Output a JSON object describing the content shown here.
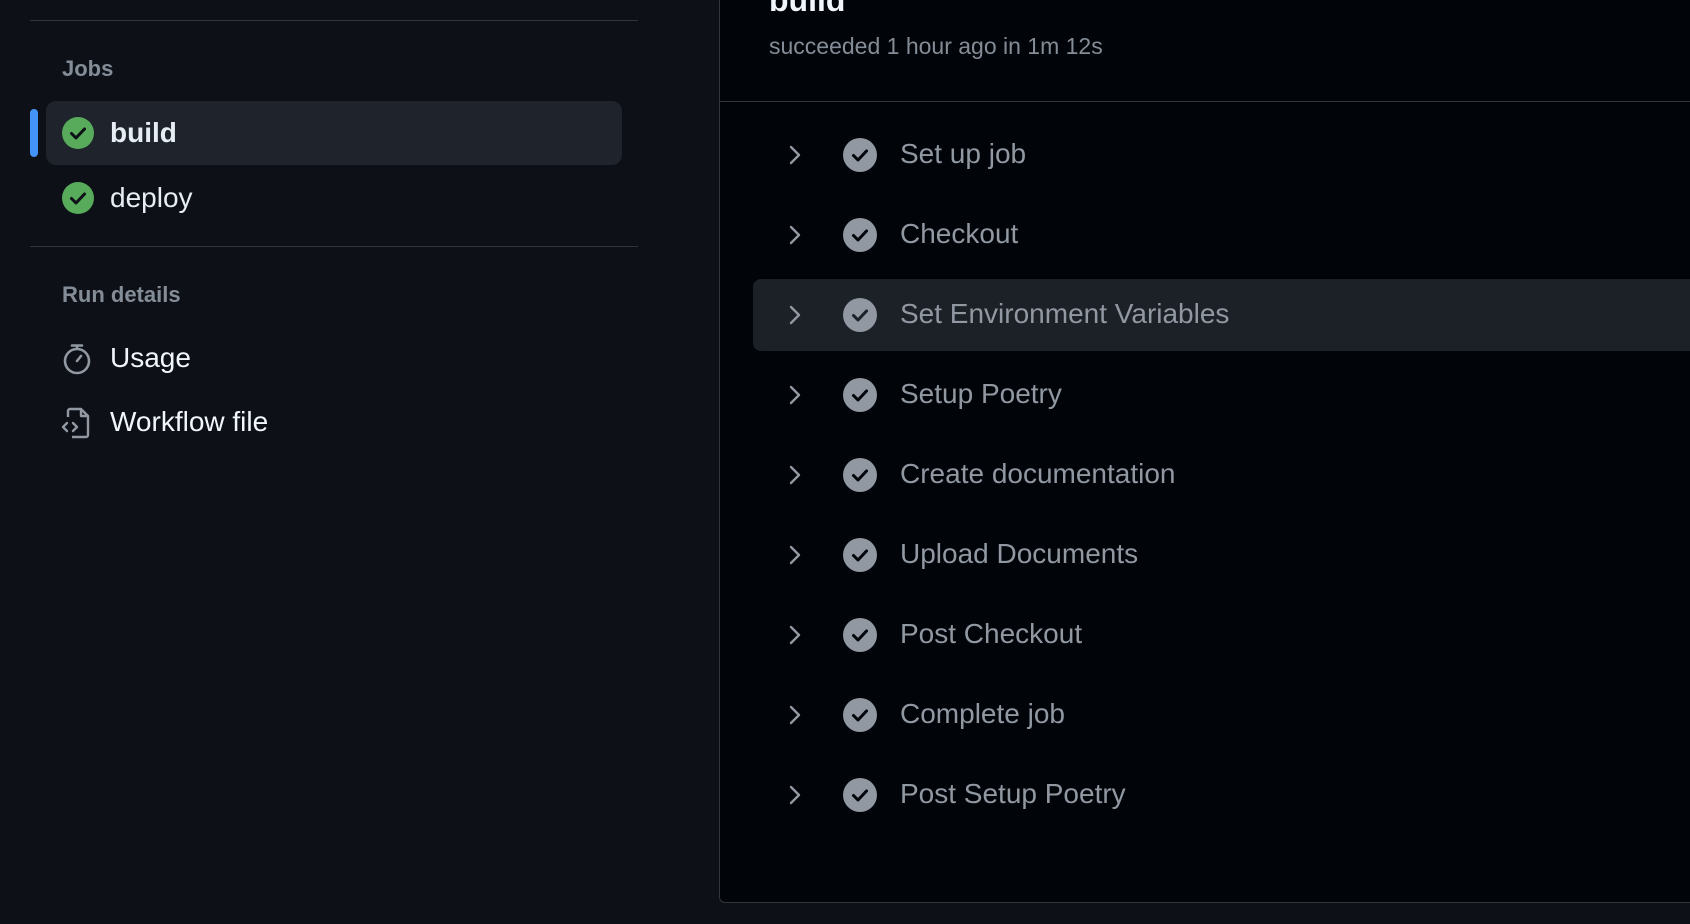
{
  "sidebar": {
    "jobs_title": "Jobs",
    "jobs": [
      {
        "label": "build",
        "status": "success",
        "selected": true
      },
      {
        "label": "deploy",
        "status": "success",
        "selected": false
      }
    ],
    "run_details_title": "Run details",
    "details": [
      {
        "label": "Usage",
        "icon": "stopwatch-icon"
      },
      {
        "label": "Workflow file",
        "icon": "file-code-icon"
      }
    ]
  },
  "main": {
    "title": "build",
    "status_text": "succeeded 1 hour ago in 1m 12s",
    "steps": [
      {
        "label": "Set up job"
      },
      {
        "label": "Checkout"
      },
      {
        "label": "Set Environment Variables"
      },
      {
        "label": "Setup Poetry"
      },
      {
        "label": "Create documentation"
      },
      {
        "label": "Upload Documents"
      },
      {
        "label": "Post Checkout"
      },
      {
        "label": "Complete job"
      },
      {
        "label": "Post Setup Poetry"
      }
    ]
  },
  "colors": {
    "success": "#57ab5a",
    "step_check": "#9198a1",
    "accent": "#4493f8",
    "background": "#0d1117",
    "panel_background": "#010409"
  }
}
